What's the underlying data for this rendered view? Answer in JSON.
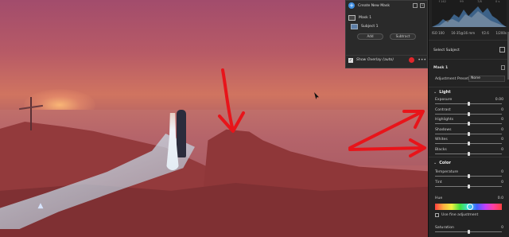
{
  "mask_popup": {
    "create_label": "Create New Mask",
    "mask_name": "Mask 1",
    "subject_name": "Subject 1",
    "add_label": "Add",
    "subtract_label": "Subtract",
    "overlay_label": "Show Overlay (auto)",
    "overlay_color": "#e0262b"
  },
  "histogram": {
    "top_labels": [
      "f 142",
      "99",
      "7/8",
      "0 s"
    ]
  },
  "camera_info": {
    "iso": "ISO 100",
    "focal": "16-35@16 mm",
    "aperture": "f/2.6",
    "shutter": "1/200s"
  },
  "panel": {
    "select_subject": "Select Subject",
    "mask_name": "Mask 1",
    "adjustment_preset_label": "Adjustment Preset",
    "adjustment_preset_value": "None",
    "light_section": "Light",
    "color_section": "Color",
    "light_sliders": [
      {
        "label": "Exposure",
        "value": "0.00",
        "level": 0.5
      },
      {
        "label": "Contrast",
        "value": "0",
        "level": 0.5
      },
      {
        "label": "Highlights",
        "value": "0",
        "level": 0.5
      },
      {
        "label": "Shadows",
        "value": "0",
        "level": 0.5
      },
      {
        "label": "Whites",
        "value": "0",
        "level": 0.5
      },
      {
        "label": "Blacks",
        "value": "0",
        "level": 0.5
      }
    ],
    "color_sliders": [
      {
        "label": "Temperature",
        "value": "0",
        "level": 0.5
      },
      {
        "label": "Tint",
        "value": "0",
        "level": 0.5
      }
    ],
    "hue_label": "Hue",
    "hue_value": "0.0",
    "fine_adjustment_label": "Use fine adjustment",
    "saturation_label": "Saturation",
    "saturation_value": "0"
  },
  "colors": {
    "accent": "#3d8de0",
    "annotation_red": "#e8141a"
  }
}
